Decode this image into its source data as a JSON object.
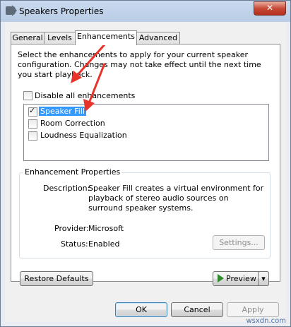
{
  "window": {
    "title": "Speakers Properties",
    "close_label": "✕"
  },
  "tabs": [
    {
      "label": "General"
    },
    {
      "label": "Levels"
    },
    {
      "label": "Enhancements"
    },
    {
      "label": "Advanced"
    }
  ],
  "enhancements": {
    "description": "Select the enhancements to apply for your current speaker configuration. Changes may not take effect until the next time you start playback.",
    "disable_all": {
      "label": "Disable all enhancements",
      "checked": false
    },
    "items": [
      {
        "label": "Speaker Fill",
        "checked": true,
        "selected": true
      },
      {
        "label": "Room Correction",
        "checked": false,
        "selected": false
      },
      {
        "label": "Loudness Equalization",
        "checked": false,
        "selected": false
      }
    ]
  },
  "properties": {
    "group_title": "Enhancement Properties",
    "description_label": "Description:",
    "description_value": "Speaker Fill creates a virtual environment for playback of stereo audio sources on surround speaker systems.",
    "provider_label": "Provider:",
    "provider_value": "Microsoft",
    "status_label": "Status:",
    "status_value": "Enabled",
    "settings_button": "Settings..."
  },
  "buttons": {
    "restore_defaults": "Restore Defaults",
    "preview": "Preview",
    "preview_dropdown": "▾",
    "ok": "OK",
    "cancel": "Cancel",
    "apply": "Apply"
  },
  "watermark": "wsxdn.com",
  "colors": {
    "selection": "#3399ff",
    "annotation_arrow": "#e8332a"
  }
}
